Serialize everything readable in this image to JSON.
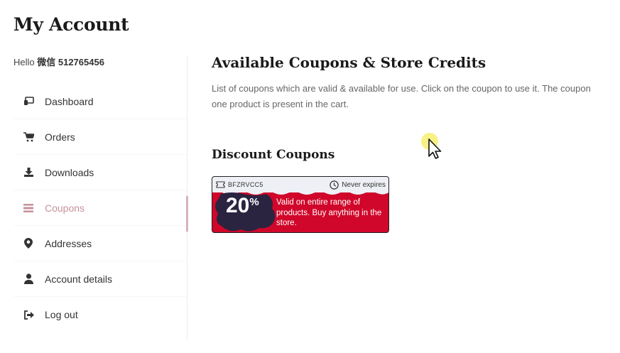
{
  "page": {
    "title": "My Account"
  },
  "sidebar": {
    "greeting": "Hello",
    "username": "微信 512765456",
    "items": [
      {
        "label": "Dashboard",
        "icon": "dashboard-icon"
      },
      {
        "label": "Orders",
        "icon": "cart-icon"
      },
      {
        "label": "Downloads",
        "icon": "download-icon"
      },
      {
        "label": "Coupons",
        "icon": "menu-lines-icon",
        "active": true
      },
      {
        "label": "Addresses",
        "icon": "location-pin-icon"
      },
      {
        "label": "Account details",
        "icon": "user-icon"
      },
      {
        "label": "Log out",
        "icon": "logout-icon"
      }
    ]
  },
  "main": {
    "heading": "Available Coupons & Store Credits",
    "description_line1": "List of coupons which are valid & available for use. Click on the coupon to use it. The coupon",
    "description_line2": "one product is present in the cart.",
    "discount_heading": "Discount Coupons",
    "coupon": {
      "code": "BFZRVCC5",
      "expiry": "Never expires",
      "amount": "20",
      "amount_suffix": "%",
      "description": "Valid on entire range of products. Buy anything in the store."
    }
  },
  "colors": {
    "accent": "#c6919c",
    "coupon_red": "#d0072a",
    "coupon_dark": "#2b2440",
    "coupon_light": "#eef0f5",
    "cursor_highlight": "#f7ee70"
  }
}
